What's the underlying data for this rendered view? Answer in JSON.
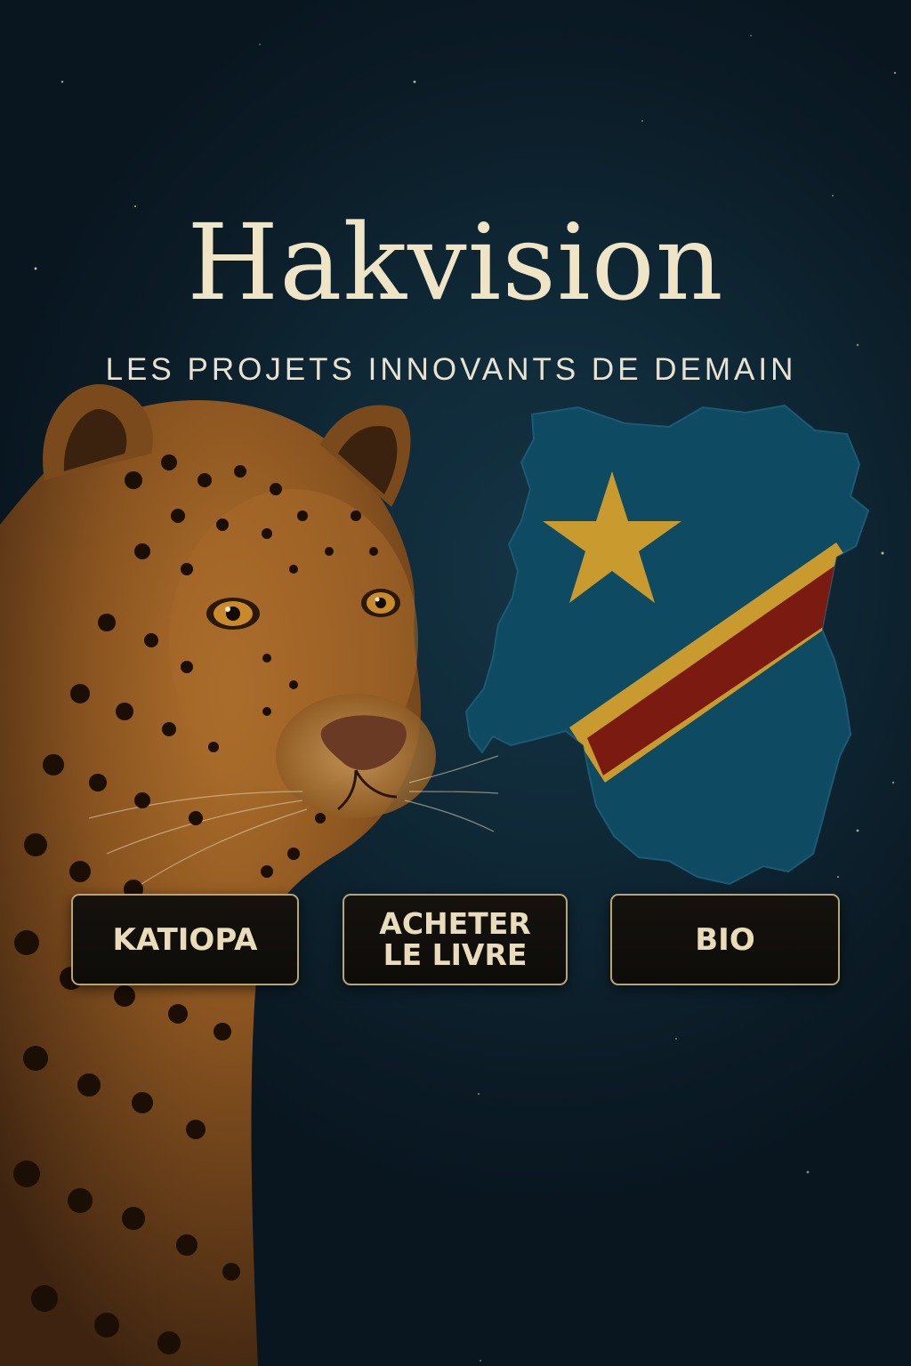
{
  "header": {
    "title": "Hakvision",
    "subtitle": "LES PROJETS INNOVANTS DE DEMAIN"
  },
  "buttons": {
    "katiopa": "KATIOPA",
    "acheter_line1": "ACHETER",
    "acheter_line2": "LE LIVRE",
    "bio": "BIO"
  },
  "icons": {
    "leopard": "leopard-illustration",
    "map": "drc-map-flag",
    "star": "star-icon"
  },
  "colors": {
    "background": "#0f2836",
    "title": "#efe4c6",
    "button_border": "#b9a572",
    "flag_blue": "#0f4a63",
    "flag_yellow": "#c99a2e",
    "flag_red": "#7a1a10"
  }
}
